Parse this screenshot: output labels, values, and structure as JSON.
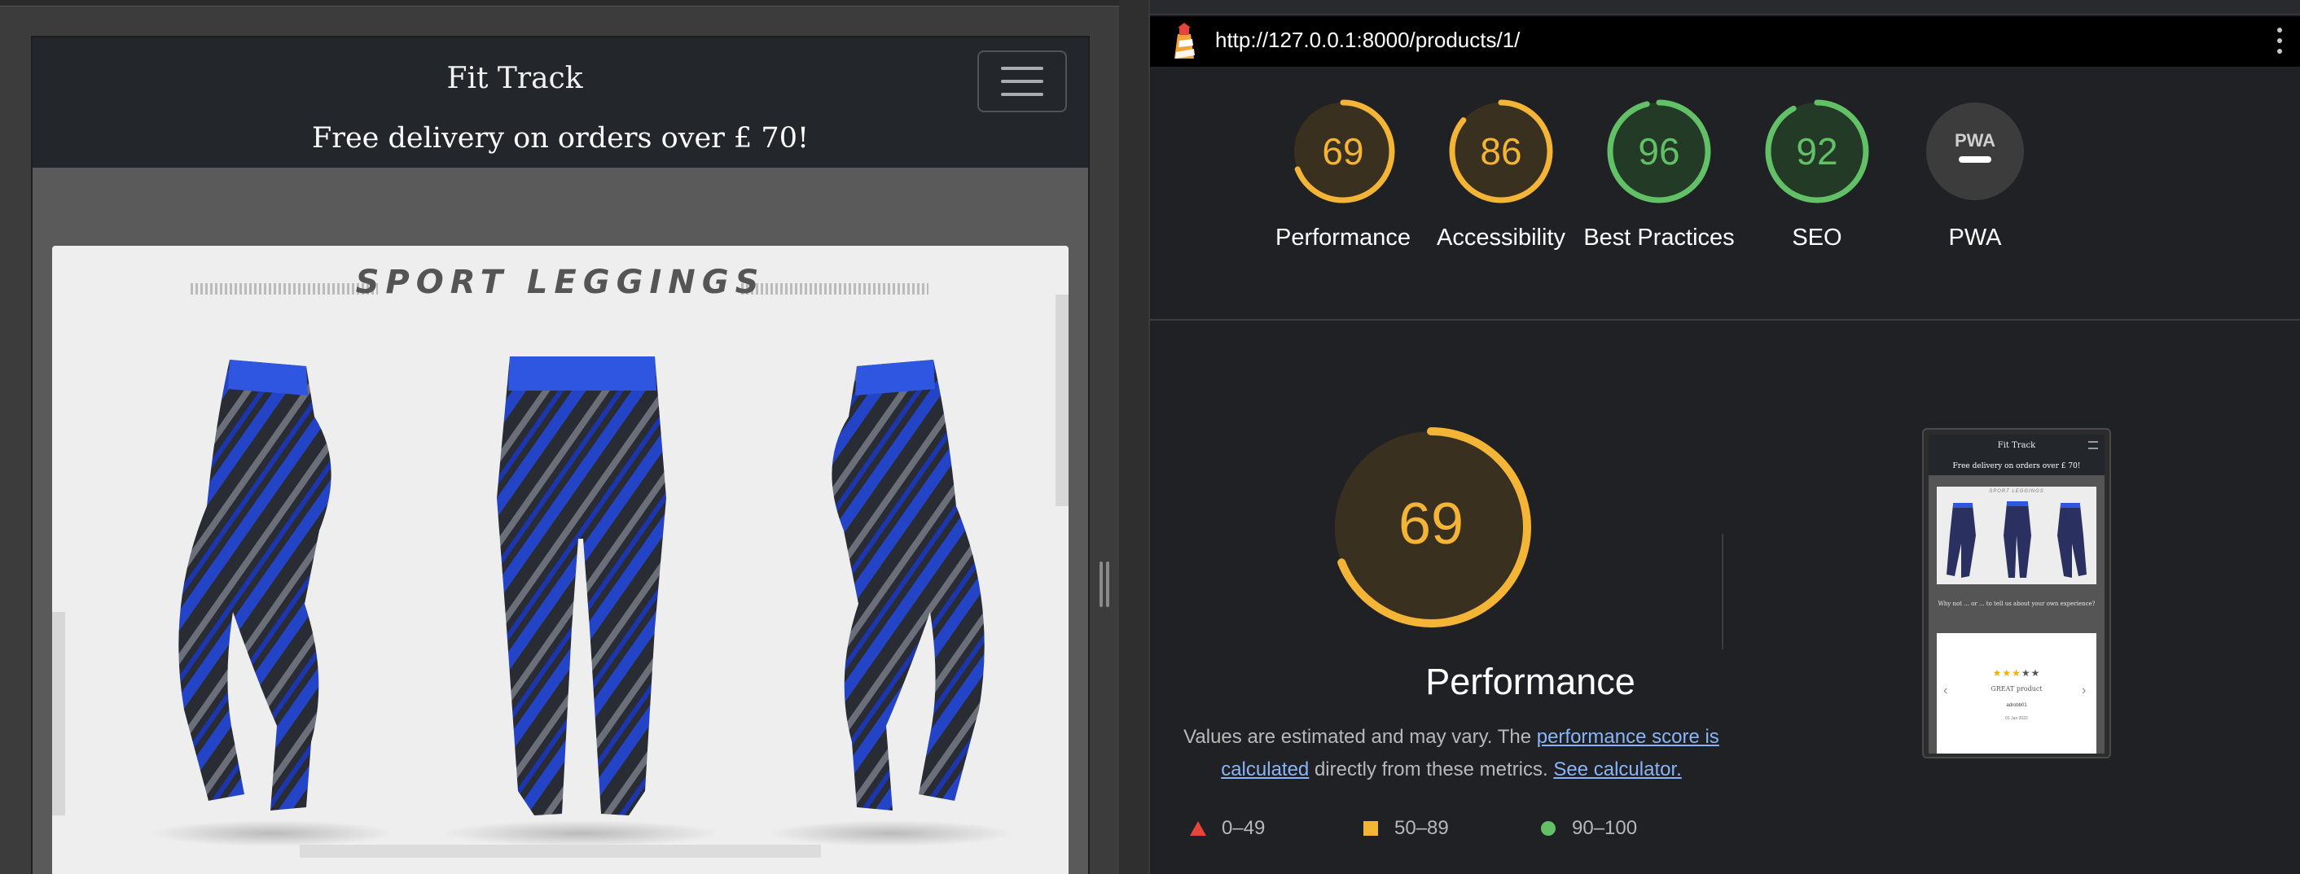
{
  "site": {
    "brand": "Fit Track",
    "delivery_banner": "Free delivery on orders over £ 70!",
    "product_image_heading": "SPORT LEGGINGS"
  },
  "lighthouse": {
    "url": "http://127.0.0.1:8000/products/1/",
    "categories": [
      {
        "label": "Performance",
        "score": "69",
        "score_fraction": 0.69,
        "status": "average",
        "color": "#f4b436"
      },
      {
        "label": "Accessibility",
        "score": "86",
        "score_fraction": 0.86,
        "status": "average",
        "color": "#f4b436"
      },
      {
        "label": "Best Practices",
        "score": "96",
        "score_fraction": 0.96,
        "status": "pass",
        "color": "#62c166"
      },
      {
        "label": "SEO",
        "score": "92",
        "score_fraction": 0.92,
        "status": "pass",
        "color": "#62c166"
      },
      {
        "label": "PWA",
        "score": "",
        "badge": "PWA",
        "status": "n/a",
        "color": "#9e9e9e"
      }
    ],
    "performance": {
      "score": "69",
      "score_fraction": 0.69,
      "title": "Performance",
      "description_part1": "Values are estimated and may vary. The ",
      "description_link1": "performance score is calculated",
      "description_part2": " directly from these metrics. ",
      "description_link2": "See calculator."
    },
    "legend": [
      {
        "icon": "triangle-icon",
        "label": "0–49",
        "color": "#e5463a"
      },
      {
        "icon": "square-icon",
        "label": "50–89",
        "color": "#f4b436"
      },
      {
        "icon": "circle-icon",
        "label": "90–100",
        "color": "#62c166"
      }
    ],
    "thumbnail": {
      "brand": "Fit Track",
      "delivery": "Free delivery on orders over £ 70!",
      "image_heading": "SPORT LEGGINGS",
      "review_question": "Why not ... or ... to tell us about your own experience?",
      "stars_on": "★★★",
      "stars_off": "★★",
      "review_title": "GREAT product",
      "review_author": "adrobb01",
      "review_date": "01 Jan 2022"
    }
  },
  "colors": {
    "accent_orange": "#f4b436",
    "accent_green": "#62c166",
    "accent_red": "#e5463a",
    "link": "#8ab4f8"
  }
}
